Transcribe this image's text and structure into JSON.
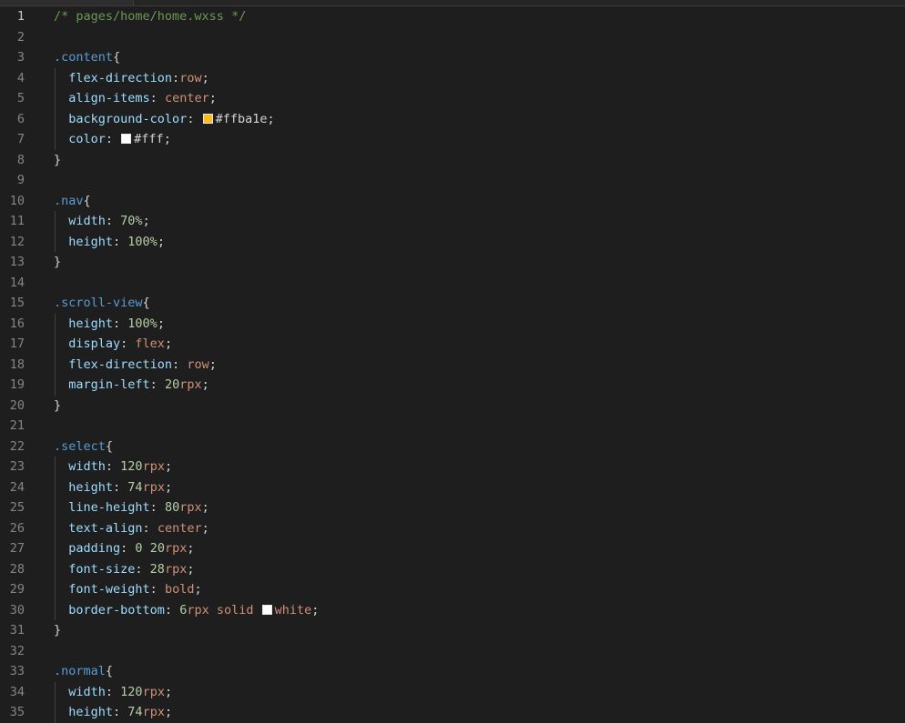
{
  "editor": {
    "file_comment": "/* pages/home/home.wxss */",
    "active_line": 1,
    "colors": {
      "background": "#1e1e1e",
      "comment": "#6a9955",
      "selector": "#569cd6",
      "property": "#9cdcfe",
      "string_value": "#ce9178",
      "number": "#b5cea8",
      "line_number": "#858585",
      "swatch_orange": "#ffba1e",
      "swatch_white": "#ffffff"
    },
    "lines": [
      {
        "n": "1",
        "tokens": [
          {
            "t": "/* pages/home/home.wxss */",
            "c": "comment"
          }
        ]
      },
      {
        "n": "2",
        "tokens": []
      },
      {
        "n": "3",
        "tokens": [
          {
            "t": ".content",
            "c": "selector"
          },
          {
            "t": "{",
            "c": "brace"
          }
        ]
      },
      {
        "n": "4",
        "tokens": [
          {
            "t": "  flex-direction",
            "c": "prop"
          },
          {
            "t": ":",
            "c": "punct"
          },
          {
            "t": "row",
            "c": "value"
          },
          {
            "t": ";",
            "c": "punct"
          }
        ]
      },
      {
        "n": "5",
        "tokens": [
          {
            "t": "  align-items",
            "c": "prop"
          },
          {
            "t": ": ",
            "c": "punct"
          },
          {
            "t": "center",
            "c": "value"
          },
          {
            "t": ";",
            "c": "punct"
          }
        ]
      },
      {
        "n": "6",
        "tokens": [
          {
            "t": "  background-color",
            "c": "prop"
          },
          {
            "t": ": ",
            "c": "punct"
          },
          {
            "swatch": "#ffba1e"
          },
          {
            "t": "#ffba1e",
            "c": "punct"
          },
          {
            "t": ";",
            "c": "punct"
          }
        ]
      },
      {
        "n": "7",
        "tokens": [
          {
            "t": "  color",
            "c": "prop"
          },
          {
            "t": ": ",
            "c": "punct"
          },
          {
            "swatch": "#ffffff"
          },
          {
            "t": "#fff",
            "c": "punct"
          },
          {
            "t": ";",
            "c": "punct"
          }
        ]
      },
      {
        "n": "8",
        "tokens": [
          {
            "t": "}",
            "c": "brace"
          }
        ]
      },
      {
        "n": "9",
        "tokens": []
      },
      {
        "n": "10",
        "tokens": [
          {
            "t": ".nav",
            "c": "selector"
          },
          {
            "t": "{",
            "c": "brace"
          }
        ]
      },
      {
        "n": "11",
        "tokens": [
          {
            "t": "  width",
            "c": "prop"
          },
          {
            "t": ": ",
            "c": "punct"
          },
          {
            "t": "70%",
            "c": "num"
          },
          {
            "t": ";",
            "c": "punct"
          }
        ]
      },
      {
        "n": "12",
        "tokens": [
          {
            "t": "  height",
            "c": "prop"
          },
          {
            "t": ": ",
            "c": "punct"
          },
          {
            "t": "100%",
            "c": "num"
          },
          {
            "t": ";",
            "c": "punct"
          }
        ]
      },
      {
        "n": "13",
        "tokens": [
          {
            "t": "}",
            "c": "brace"
          }
        ]
      },
      {
        "n": "14",
        "tokens": []
      },
      {
        "n": "15",
        "tokens": [
          {
            "t": ".scroll-view",
            "c": "selector"
          },
          {
            "t": "{",
            "c": "brace"
          }
        ]
      },
      {
        "n": "16",
        "tokens": [
          {
            "t": "  height",
            "c": "prop"
          },
          {
            "t": ": ",
            "c": "punct"
          },
          {
            "t": "100%",
            "c": "num"
          },
          {
            "t": ";",
            "c": "punct"
          }
        ]
      },
      {
        "n": "17",
        "tokens": [
          {
            "t": "  display",
            "c": "prop"
          },
          {
            "t": ": ",
            "c": "punct"
          },
          {
            "t": "flex",
            "c": "value"
          },
          {
            "t": ";",
            "c": "punct"
          }
        ]
      },
      {
        "n": "18",
        "tokens": [
          {
            "t": "  flex-direction",
            "c": "prop"
          },
          {
            "t": ": ",
            "c": "punct"
          },
          {
            "t": "row",
            "c": "value"
          },
          {
            "t": ";",
            "c": "punct"
          }
        ]
      },
      {
        "n": "19",
        "tokens": [
          {
            "t": "  margin-left",
            "c": "prop"
          },
          {
            "t": ": ",
            "c": "punct"
          },
          {
            "t": "20",
            "c": "num"
          },
          {
            "t": "rpx",
            "c": "unit"
          },
          {
            "t": ";",
            "c": "punct"
          }
        ]
      },
      {
        "n": "20",
        "tokens": [
          {
            "t": "}",
            "c": "brace"
          }
        ]
      },
      {
        "n": "21",
        "tokens": []
      },
      {
        "n": "22",
        "tokens": [
          {
            "t": ".select",
            "c": "selector"
          },
          {
            "t": "{",
            "c": "brace"
          }
        ]
      },
      {
        "n": "23",
        "tokens": [
          {
            "t": "  width",
            "c": "prop"
          },
          {
            "t": ": ",
            "c": "punct"
          },
          {
            "t": "120",
            "c": "num"
          },
          {
            "t": "rpx",
            "c": "unit"
          },
          {
            "t": ";",
            "c": "punct"
          }
        ]
      },
      {
        "n": "24",
        "tokens": [
          {
            "t": "  height",
            "c": "prop"
          },
          {
            "t": ": ",
            "c": "punct"
          },
          {
            "t": "74",
            "c": "num"
          },
          {
            "t": "rpx",
            "c": "unit"
          },
          {
            "t": ";",
            "c": "punct"
          }
        ]
      },
      {
        "n": "25",
        "tokens": [
          {
            "t": "  line-height",
            "c": "prop"
          },
          {
            "t": ": ",
            "c": "punct"
          },
          {
            "t": "80",
            "c": "num"
          },
          {
            "t": "rpx",
            "c": "unit"
          },
          {
            "t": ";",
            "c": "punct"
          }
        ]
      },
      {
        "n": "26",
        "tokens": [
          {
            "t": "  text-align",
            "c": "prop"
          },
          {
            "t": ": ",
            "c": "punct"
          },
          {
            "t": "center",
            "c": "value"
          },
          {
            "t": ";",
            "c": "punct"
          }
        ]
      },
      {
        "n": "27",
        "tokens": [
          {
            "t": "  padding",
            "c": "prop"
          },
          {
            "t": ": ",
            "c": "punct"
          },
          {
            "t": "0",
            "c": "num"
          },
          {
            "t": " ",
            "c": "punct"
          },
          {
            "t": "20",
            "c": "num"
          },
          {
            "t": "rpx",
            "c": "unit"
          },
          {
            "t": ";",
            "c": "punct"
          }
        ]
      },
      {
        "n": "28",
        "tokens": [
          {
            "t": "  font-size",
            "c": "prop"
          },
          {
            "t": ": ",
            "c": "punct"
          },
          {
            "t": "28",
            "c": "num"
          },
          {
            "t": "rpx",
            "c": "unit"
          },
          {
            "t": ";",
            "c": "punct"
          }
        ]
      },
      {
        "n": "29",
        "tokens": [
          {
            "t": "  font-weight",
            "c": "prop"
          },
          {
            "t": ": ",
            "c": "punct"
          },
          {
            "t": "bold",
            "c": "value"
          },
          {
            "t": ";",
            "c": "punct"
          }
        ]
      },
      {
        "n": "30",
        "tokens": [
          {
            "t": "  border-bottom",
            "c": "prop"
          },
          {
            "t": ": ",
            "c": "punct"
          },
          {
            "t": "6",
            "c": "num"
          },
          {
            "t": "rpx",
            "c": "unit"
          },
          {
            "t": " solid ",
            "c": "value"
          },
          {
            "swatch": "#ffffff"
          },
          {
            "t": "white",
            "c": "value"
          },
          {
            "t": ";",
            "c": "punct"
          }
        ]
      },
      {
        "n": "31",
        "tokens": [
          {
            "t": "}",
            "c": "brace"
          }
        ]
      },
      {
        "n": "32",
        "tokens": []
      },
      {
        "n": "33",
        "tokens": [
          {
            "t": ".normal",
            "c": "selector"
          },
          {
            "t": "{",
            "c": "brace"
          }
        ]
      },
      {
        "n": "34",
        "tokens": [
          {
            "t": "  width",
            "c": "prop"
          },
          {
            "t": ": ",
            "c": "punct"
          },
          {
            "t": "120",
            "c": "num"
          },
          {
            "t": "rpx",
            "c": "unit"
          },
          {
            "t": ";",
            "c": "punct"
          }
        ]
      },
      {
        "n": "35",
        "tokens": [
          {
            "t": "  height",
            "c": "prop"
          },
          {
            "t": ": ",
            "c": "punct"
          },
          {
            "t": "74",
            "c": "num"
          },
          {
            "t": "rpx",
            "c": "unit"
          },
          {
            "t": ";",
            "c": "punct"
          }
        ]
      }
    ]
  }
}
